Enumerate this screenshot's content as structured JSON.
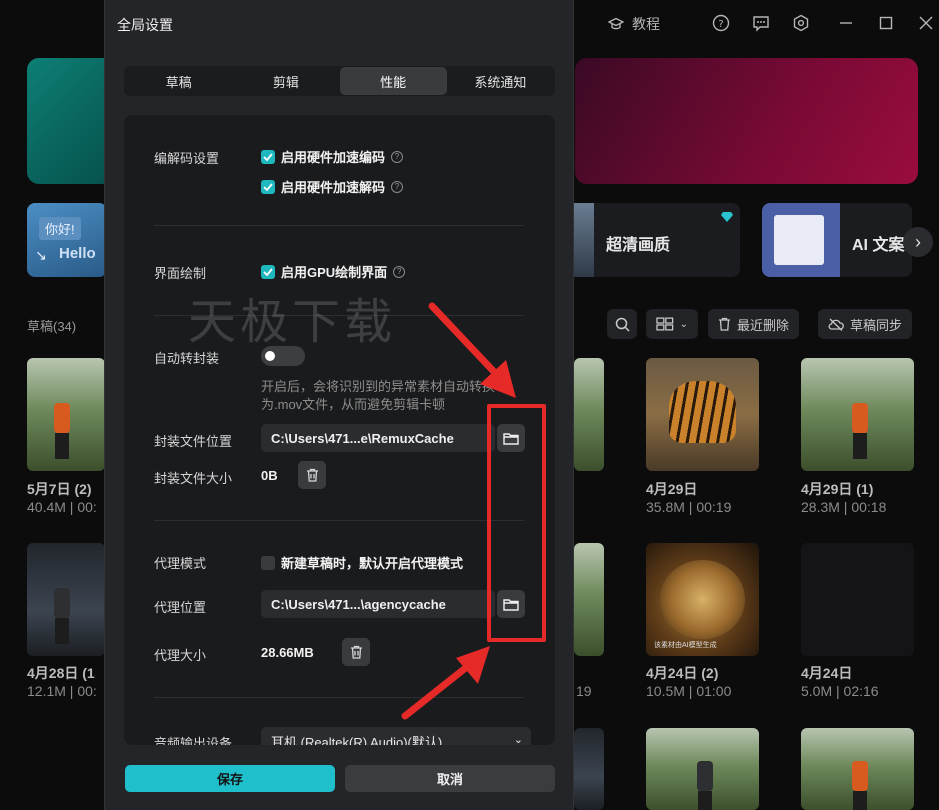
{
  "titlebar": {
    "tutorial_label": "教程"
  },
  "features": {
    "card_left_thumb_text": "你好!",
    "card_left_label": "Hello",
    "card_mid_label": "超清画质",
    "card_right_label": "AI 文案"
  },
  "drafts": {
    "title": "草稿(34)",
    "recent_delete": "最近删除",
    "draft_sync": "草稿同步"
  },
  "thumbs": [
    {
      "date": "5月7日 (2)",
      "meta": "40.4M | 00:"
    },
    {
      "date": "4月29日",
      "meta": "35.8M | 00:19"
    },
    {
      "date": "4月29日 (1)",
      "meta": "28.3M | 00:18"
    },
    {
      "date": "4月28日 (1",
      "meta": "12.1M | 00:"
    },
    {
      "date": "",
      "meta": "19"
    },
    {
      "date": "4月24日 (2)",
      "meta": "10.5M | 01:00"
    },
    {
      "date": "4月24日",
      "meta": "5.0M | 02:16"
    }
  ],
  "food_caption": "该素材由AI模型生成",
  "dialog": {
    "title": "全局设置",
    "tabs": [
      "草稿",
      "剪辑",
      "性能",
      "系统通知"
    ],
    "active_tab": "性能",
    "codec_label": "编解码设置",
    "hw_encode": "启用硬件加速编码",
    "hw_decode": "启用硬件加速解码",
    "render_label": "界面绘制",
    "gpu_render": "启用GPU绘制界面",
    "auto_remux_label": "自动转封装",
    "auto_remux_hint": "开启后，会将识别到的异常素材自动转换为.mov文件，从而避免剪辑卡顿",
    "remux_location_label": "封装文件位置",
    "remux_location_value": "C:\\Users\\471...e\\RemuxCache",
    "remux_size_label": "封装文件大小",
    "remux_size_value": "0B",
    "proxy_mode_label": "代理模式",
    "proxy_mode_option": "新建草稿时，默认开启代理模式",
    "proxy_location_label": "代理位置",
    "proxy_location_value": "C:\\Users\\471...\\agencycache",
    "proxy_size_label": "代理大小",
    "proxy_size_value": "28.66MB",
    "audio_output_label": "音频输出设备",
    "audio_output_value": "耳机 (Realtek(R) Audio)(默认)",
    "save_label": "保存",
    "cancel_label": "取消"
  },
  "watermark": "天极下载",
  "colors": {
    "accent": "#1fbfcb",
    "highlight": "#e52a28"
  }
}
